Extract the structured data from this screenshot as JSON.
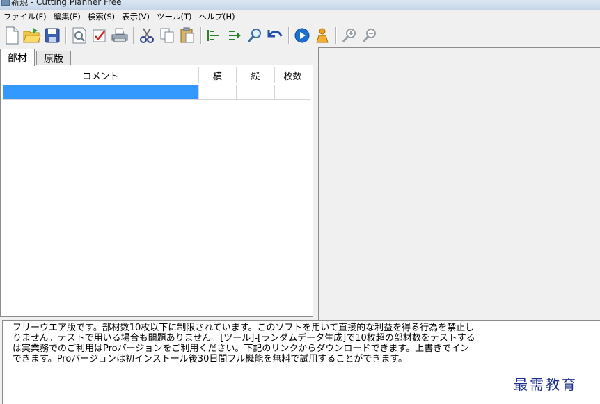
{
  "window": {
    "title": "新規 - Cutting Planner Free"
  },
  "menu": [
    {
      "label": "ファイル(F)"
    },
    {
      "label": "編集(E)"
    },
    {
      "label": "検索(S)"
    },
    {
      "label": "表示(V)"
    },
    {
      "label": "ツール(T)"
    },
    {
      "label": "ヘルプ(H)"
    }
  ],
  "toolbar": {
    "icons": [
      "new-file-icon",
      "open-folder-icon",
      "save-icon",
      "preview-icon",
      "check-icon",
      "print-icon",
      "cut-icon",
      "copy-icon",
      "paste-icon",
      "align-left-icon",
      "align-right-icon",
      "search-icon",
      "undo-icon",
      "run-icon",
      "optimize-icon",
      "zoom-in-icon",
      "zoom-out-icon"
    ]
  },
  "tabs": {
    "parts": "部材",
    "stock": "原版"
  },
  "grid": {
    "headers": [
      "コメント",
      "横",
      "縦",
      "枚数"
    ],
    "rows": [
      [
        "",
        "",
        "",
        ""
      ]
    ]
  },
  "notice": {
    "lines": [
      "フリーウエア版です。部材数10枚以下に制限されています。このソフトを用いて直接的な利益を得る行為を禁止し",
      "りません。テストで用いる場合も問題ありません。[ツール]-[ランダムデータ生成]で10枚超の部材数をテストする",
      "は実業務でのご利用はProバージョンをご利用ください。下記のリンクからダウンロードできます。上書きでイン",
      "できます。Proバージョンは初インストール後30日間フル機能を無料で試用することができます。"
    ]
  },
  "watermark": "最需教育",
  "colors": {
    "selection": "#3399ff",
    "watermark": "#1a2c8c"
  }
}
